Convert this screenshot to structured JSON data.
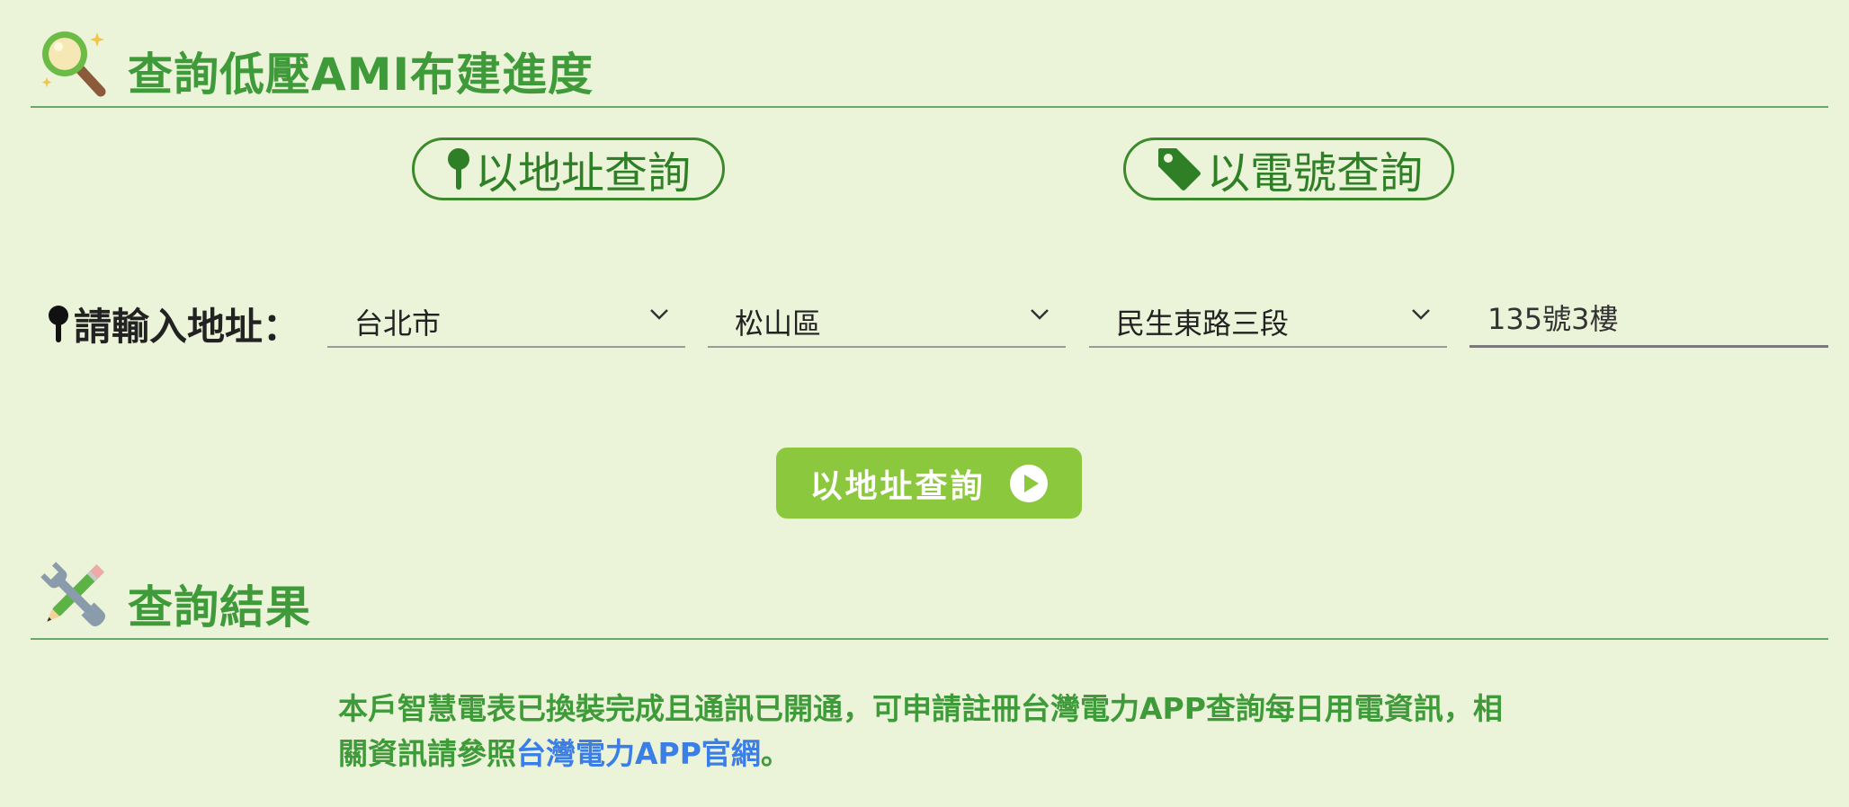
{
  "query_section": {
    "title": "查詢低壓AMI布建進度",
    "icon": "magnifier-sparkle-icon"
  },
  "mode_buttons": {
    "by_address": {
      "label": "以地址查詢",
      "icon": "map-pin-icon"
    },
    "by_meter": {
      "label": "以電號查詢",
      "icon": "tag-icon"
    }
  },
  "address_form": {
    "label": "請輸入地址：",
    "label_icon": "map-pin-icon",
    "city": "台北市",
    "district": "松山區",
    "road": "民生東路三段",
    "detail": "135號3樓"
  },
  "submit_button": {
    "label": "以地址查詢",
    "icon": "play-circle-icon"
  },
  "result_section": {
    "title": "查詢結果",
    "icon": "wrench-pencil-icon",
    "message_prefix": "本戶智慧電表已換裝完成且通訊已開通，可申請註冊台灣電力APP查詢每日用電資訊，相關資訊請參照",
    "link_text": "台灣電力APP官網",
    "message_suffix": "。"
  },
  "colors": {
    "background": "#ebf3d8",
    "heading_green": "#3f9a3a",
    "button_green": "#8cc83e",
    "link_blue": "#3b7ee6"
  }
}
